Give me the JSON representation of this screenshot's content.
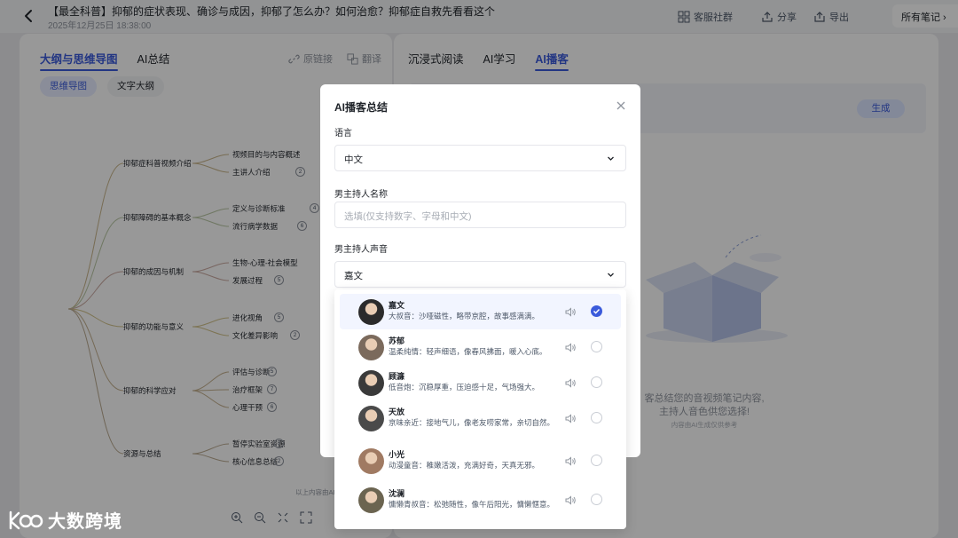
{
  "header": {
    "title": "【最全科普】抑郁的症状表现、确诊与成因，抑郁了怎么办？如何治愈？抑郁症自救先看看这个",
    "date": "2025年12月25日 18:38:00",
    "buttons": {
      "community": "客服社群",
      "share": "分享",
      "export": "导出"
    },
    "all_notes": "所有笔记 ›"
  },
  "left_panel": {
    "tabs": [
      "大纲与思维导图",
      "AI总结"
    ],
    "actions": {
      "source_link": "原链接",
      "translate": "翻译"
    },
    "pills": [
      "思维导图",
      "文字大纲"
    ],
    "mindmap": {
      "branches": [
        {
          "label": "抑郁症科普视频介绍",
          "children": [
            {
              "label": "视频目的与内容概述",
              "count": ""
            },
            {
              "label": "主讲人介绍",
              "count": "2"
            }
          ]
        },
        {
          "label": "抑郁障碍的基本概念",
          "children": [
            {
              "label": "定义与诊断标准",
              "count": "4"
            },
            {
              "label": "流行病学数据",
              "count": "6"
            }
          ]
        },
        {
          "label": "抑郁的成因与机制",
          "children": [
            {
              "label": "生物-心理-社会模型",
              "count": ""
            },
            {
              "label": "发展过程",
              "count": "5"
            }
          ]
        },
        {
          "label": "抑郁的功能与意义",
          "children": [
            {
              "label": "进化视角",
              "count": "5"
            },
            {
              "label": "文化差异影响",
              "count": "2"
            }
          ]
        },
        {
          "label": "抑郁的科学应对",
          "children": [
            {
              "label": "评估与诊断",
              "count": "5"
            },
            {
              "label": "治疗框架",
              "count": "7"
            },
            {
              "label": "心理干预",
              "count": "6"
            }
          ]
        },
        {
          "label": "资源与总结",
          "children": [
            {
              "label": "暂停实验室资源",
              "count": "3"
            },
            {
              "label": "核心信息总结",
              "count": "2"
            }
          ]
        }
      ],
      "footer": "以上内容由AI"
    }
  },
  "right_panel": {
    "tabs": [
      "沉浸式阅读",
      "AI学习",
      "AI播客"
    ],
    "generate_button": "生成",
    "empty_text_line1": "客总结您的音视频笔记内容,",
    "empty_text_line2": "主持人音色供您选择!",
    "empty_text_small": "内容由AI生成仅供参考"
  },
  "modal": {
    "title": "AI播客总结",
    "language_label": "语言",
    "language_value": "中文",
    "host_name_label": "男主持人名称",
    "host_name_placeholder": "选填(仅支持数字、字母和中文)",
    "host_voice_label": "男主持人声音",
    "host_voice_value": "嘉文"
  },
  "voices": [
    {
      "name": "嘉文",
      "desc": "大叔音：沙哑磁性，略带京腔，故事感满满。",
      "selected": true,
      "avatar_color": "#2b2b2b"
    },
    {
      "name": "苏郁",
      "desc": "温柔纯情：轻声细语，像春风拂面，暖入心底。",
      "selected": false,
      "avatar_color": "#7b6a5c"
    },
    {
      "name": "顾濂",
      "desc": "低音炮：沉稳厚重，压迫感十足，气场强大。",
      "selected": false,
      "avatar_color": "#3a3a3a"
    },
    {
      "name": "天放",
      "desc": "京味亲近：接地气儿，像老友唠家常，亲切自然。",
      "selected": false,
      "avatar_color": "#4a4a4a"
    },
    {
      "name": "小光",
      "desc": "动漫童音：稚嫩活泼，充满好奇，天真无邪。",
      "selected": false,
      "avatar_color": "#a07a62"
    },
    {
      "name": "沈澜",
      "desc": "慵懒青叔音：松弛随性，像午后阳光，慵懒惬意。",
      "selected": false,
      "avatar_color": "#6b6450"
    }
  ],
  "watermark": {
    "text": "大数跨境"
  },
  "colors": {
    "accent": "#3b5bdb",
    "overlay": "rgba(0,0,0,0.40)"
  }
}
